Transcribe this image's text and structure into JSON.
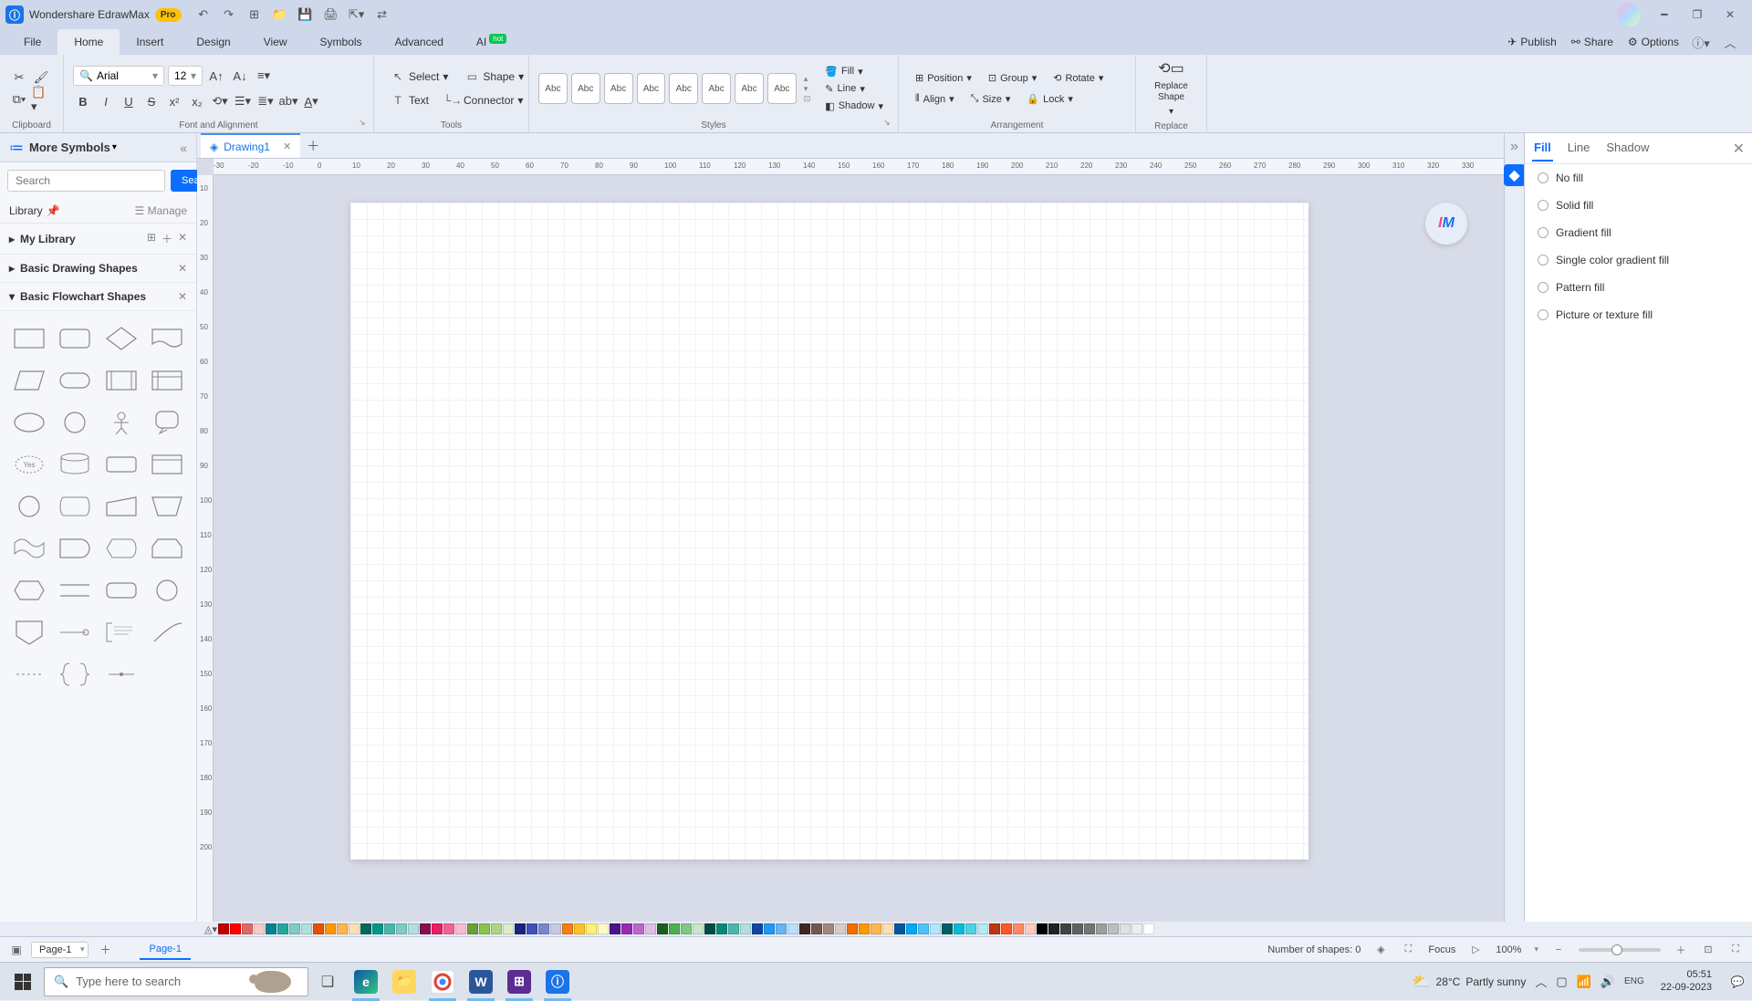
{
  "titlebar": {
    "app_name": "Wondershare EdrawMax",
    "pro": "Pro"
  },
  "menu": {
    "items": [
      "File",
      "Home",
      "Insert",
      "Design",
      "View",
      "Symbols",
      "Advanced",
      "AI"
    ],
    "hot": "hot",
    "right": {
      "publish": "Publish",
      "share": "Share",
      "options": "Options"
    }
  },
  "ribbon": {
    "clipboard": "Clipboard",
    "font_label": "Font and Alignment",
    "font_name": "Arial",
    "font_size": "12",
    "tools": "Tools",
    "select": "Select",
    "shape": "Shape",
    "text": "Text",
    "connector": "Connector",
    "styles": "Styles",
    "style_label": "Abc",
    "fill": "Fill",
    "line": "Line",
    "shadow": "Shadow",
    "arrangement": "Arrangement",
    "position": "Position",
    "group": "Group",
    "rotate": "Rotate",
    "align": "Align",
    "size": "Size",
    "lock": "Lock",
    "replace": "Replace",
    "replace_shape": "Replace\nShape"
  },
  "left": {
    "title": "More Symbols",
    "search_ph": "Search",
    "search_btn": "Search",
    "library": "Library",
    "manage": "Manage",
    "my_library": "My Library",
    "basic_drawing": "Basic Drawing Shapes",
    "basic_flowchart": "Basic Flowchart Shapes"
  },
  "doc": {
    "tab": "Drawing1"
  },
  "ruler_h": [
    "-30",
    "-20",
    "-10",
    "0",
    "10",
    "20",
    "30",
    "40",
    "50",
    "60",
    "70",
    "80",
    "90",
    "100",
    "110",
    "120",
    "130",
    "140",
    "150",
    "160",
    "170",
    "180",
    "190",
    "200",
    "210",
    "220",
    "230",
    "240",
    "250",
    "260",
    "270",
    "280",
    "290",
    "300",
    "310",
    "320",
    "330"
  ],
  "ruler_v": [
    "10",
    "20",
    "30",
    "40",
    "50",
    "60",
    "70",
    "80",
    "90",
    "100",
    "110",
    "120",
    "130",
    "140",
    "150",
    "160",
    "170",
    "180",
    "190",
    "200"
  ],
  "right": {
    "tab_fill": "Fill",
    "tab_line": "Line",
    "tab_shadow": "Shadow",
    "opts": [
      "No fill",
      "Solid fill",
      "Gradient fill",
      "Single color gradient fill",
      "Pattern fill",
      "Picture or texture fill"
    ]
  },
  "colors": [
    "#c00000",
    "#ff0000",
    "#e06666",
    "#f4cccc",
    "#00838f",
    "#26a69a",
    "#80cbc4",
    "#b2dfdb",
    "#e65100",
    "#ff9800",
    "#ffb74d",
    "#ffe0b2",
    "#00695c",
    "#009688",
    "#4db6ac",
    "#80cbc4",
    "#b2dfdb",
    "#880e4f",
    "#e91e63",
    "#f06292",
    "#f8bbd0",
    "#689f38",
    "#8bc34a",
    "#aed581",
    "#dcedc8",
    "#1a237e",
    "#3f51b5",
    "#7986cb",
    "#c5cae9",
    "#f57f17",
    "#fbc02d",
    "#fff176",
    "#fff9c4",
    "#4a148c",
    "#9c27b0",
    "#ba68c8",
    "#e1bee7",
    "#1b5e20",
    "#4caf50",
    "#81c784",
    "#c8e6c9",
    "#004d40",
    "#00897b",
    "#4db6ac",
    "#b2dfdb",
    "#0d47a1",
    "#2196f3",
    "#64b5f6",
    "#bbdefb",
    "#3e2723",
    "#795548",
    "#a1887f",
    "#d7ccc8",
    "#ef6c00",
    "#ff9800",
    "#ffb74d",
    "#ffe0b2",
    "#01579b",
    "#03a9f4",
    "#4fc3f7",
    "#b3e5fc",
    "#006064",
    "#00bcd4",
    "#4dd0e1",
    "#b2ebf2",
    "#bf360c",
    "#ff5722",
    "#ff8a65",
    "#ffccbc",
    "#000000",
    "#212121",
    "#424242",
    "#616161",
    "#757575",
    "#9e9e9e",
    "#bdbdbd",
    "#e0e0e0",
    "#eeeeee",
    "#ffffff"
  ],
  "status": {
    "page_sel": "Page-1",
    "page_tab": "Page-1",
    "shapes": "Number of shapes: 0",
    "focus": "Focus",
    "zoom": "100%"
  },
  "taskbar": {
    "search_ph": "Type here to search",
    "temp": "28°C",
    "weather": "Partly sunny",
    "time": "05:51",
    "date": "22-09-2023"
  }
}
